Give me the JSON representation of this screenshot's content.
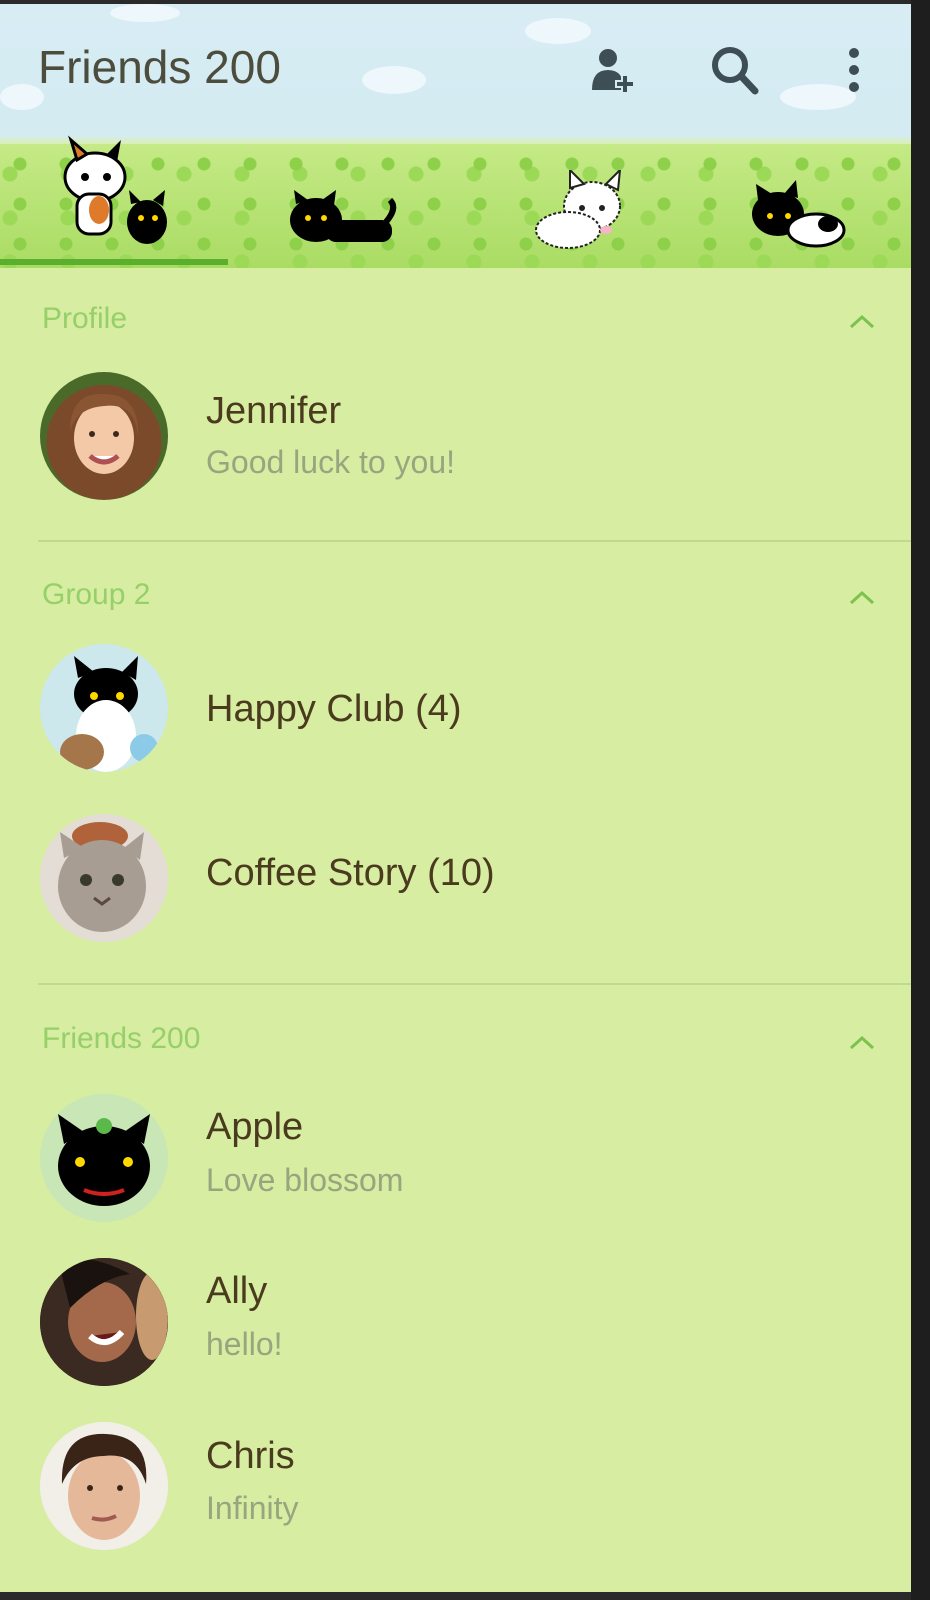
{
  "header": {
    "title": "Friends 200",
    "icons": [
      "add-friend-icon",
      "search-icon",
      "more-icon"
    ]
  },
  "sections": {
    "profile": {
      "label": "Profile",
      "user": {
        "name": "Jennifer",
        "status": "Good luck to you!"
      }
    },
    "groups": {
      "label": "Group 2",
      "items": [
        {
          "name": "Happy Club (4)"
        },
        {
          "name": "Coffee Story (10)"
        }
      ]
    },
    "friends": {
      "label": "Friends 200",
      "items": [
        {
          "name": "Apple",
          "status": "Love blossom"
        },
        {
          "name": "Ally",
          "status": "hello!"
        },
        {
          "name": "Chris",
          "status": "Infinity"
        }
      ]
    }
  },
  "colors": {
    "background": "#d6eda2",
    "section_label": "#97cf6a",
    "name_text": "#4a3b1e",
    "status_text": "#98a67f",
    "tab_indicator": "#5cae2e"
  }
}
